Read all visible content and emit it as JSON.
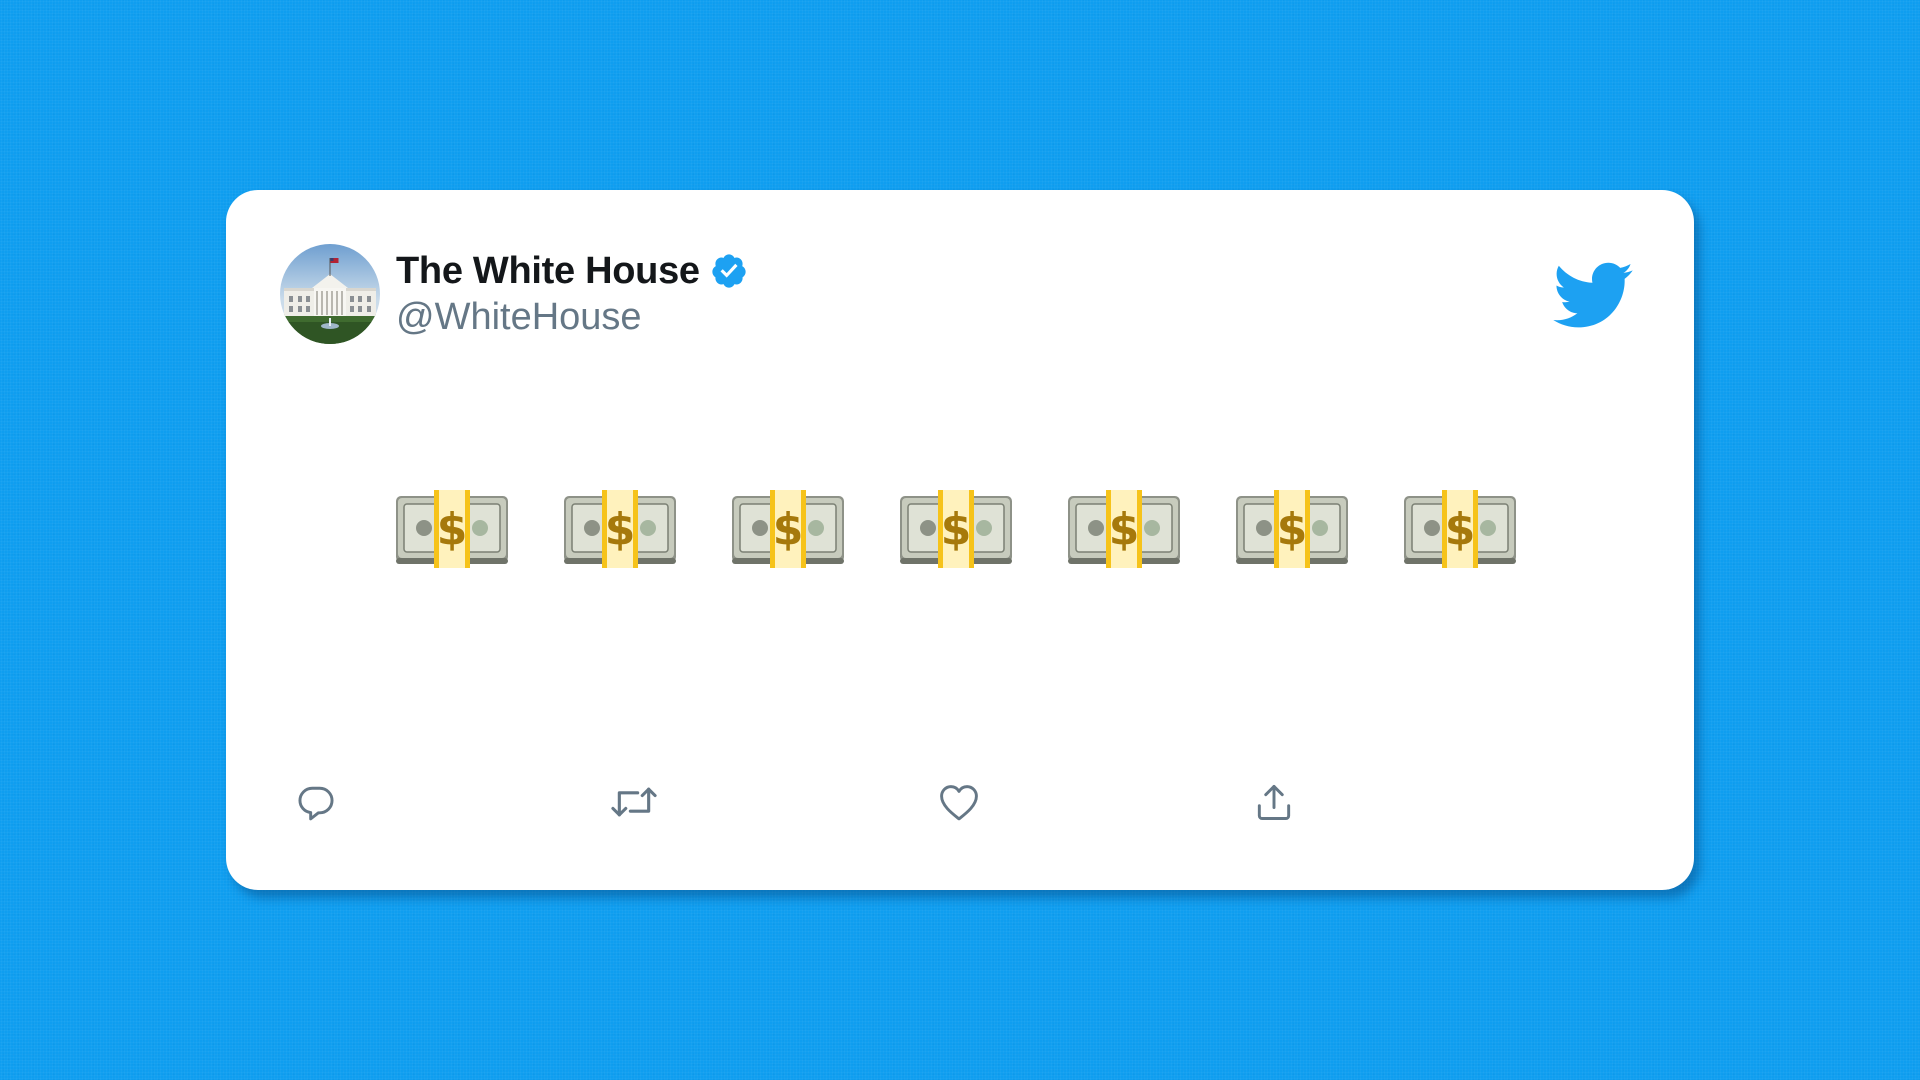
{
  "tweet": {
    "display_name": "The White House",
    "handle": "@WhiteHouse",
    "verified": true,
    "content_emoji": [
      "money-with-wings-bill-stack",
      "money-with-wings-bill-stack",
      "money-with-wings-bill-stack",
      "money-with-wings-bill-stack",
      "money-with-wings-bill-stack",
      "money-with-wings-bill-stack",
      "money-with-wings-bill-stack"
    ],
    "actions": [
      "reply-icon",
      "retweet-icon",
      "like-icon",
      "share-icon"
    ]
  },
  "colors": {
    "background": "#0f9ef0",
    "card": "#ffffff",
    "brand_blue": "#1da1f2",
    "name": "#14171a",
    "handle": "#657786",
    "action_icon": "#657786"
  },
  "icons": {
    "logo": "twitter-bird-icon",
    "verified": "verified-badge-icon"
  }
}
